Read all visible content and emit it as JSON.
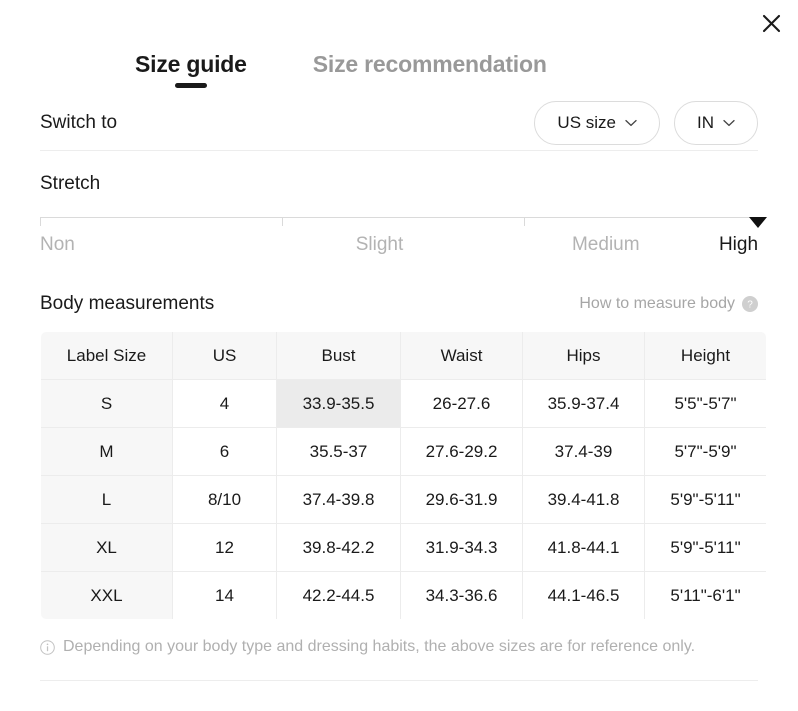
{
  "close_label": "close",
  "tabs": [
    {
      "label": "Size guide",
      "active": true
    },
    {
      "label": "Size recommendation",
      "active": false
    }
  ],
  "switch": {
    "label": "Switch to",
    "dropdowns": [
      {
        "value": "US size"
      },
      {
        "value": "IN"
      }
    ]
  },
  "stretch": {
    "title": "Stretch",
    "levels": [
      "Non",
      "Slight",
      "Medium",
      "High"
    ],
    "selected": "High"
  },
  "measurements": {
    "title": "Body measurements",
    "how_to_link": "How to measure body",
    "columns": [
      "Label Size",
      "US",
      "Bust",
      "Waist",
      "Hips",
      "Height"
    ],
    "rows": [
      {
        "cells": [
          "S",
          "4",
          "33.9-35.5",
          "26-27.6",
          "35.9-37.4",
          "5'5\"-5'7\""
        ],
        "highlight_index": 2
      },
      {
        "cells": [
          "M",
          "6",
          "35.5-37",
          "27.6-29.2",
          "37.4-39",
          "5'7\"-5'9\""
        ],
        "highlight_index": -1
      },
      {
        "cells": [
          "L",
          "8/10",
          "37.4-39.8",
          "29.6-31.9",
          "39.4-41.8",
          "5'9\"-5'11\""
        ],
        "highlight_index": -1
      },
      {
        "cells": [
          "XL",
          "12",
          "39.8-42.2",
          "31.9-34.3",
          "41.8-44.1",
          "5'9\"-5'11\""
        ],
        "highlight_index": -1
      },
      {
        "cells": [
          "XXL",
          "14",
          "42.2-44.5",
          "34.3-36.6",
          "44.1-46.5",
          "5'11\"-6'1\""
        ],
        "highlight_index": -1
      }
    ]
  },
  "footnote": "Depending on your body type and dressing habits, the above sizes are for reference only.",
  "colors": {
    "text": "#1a1a1a",
    "muted": "#b3b3b3",
    "inactive_tab": "#999999",
    "header_bg": "#f7f7f7",
    "highlight_bg": "#ebebeb",
    "border": "#ececec"
  }
}
